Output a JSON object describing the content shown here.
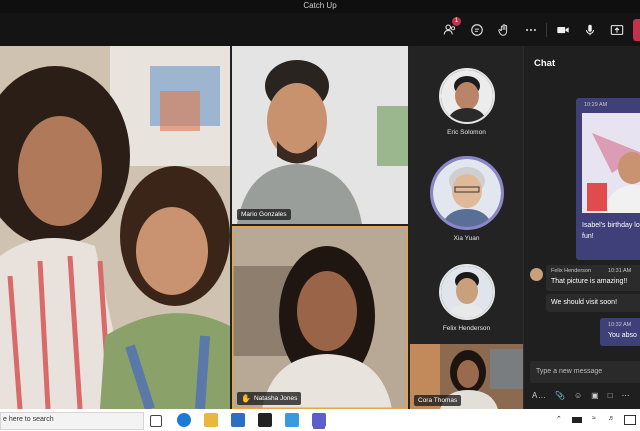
{
  "window": {
    "title": "Catch Up"
  },
  "toolbar": {
    "participants_badge": "1",
    "icons": [
      "people-icon",
      "chat-icon",
      "raise-hand-icon",
      "more-icon",
      "camera-icon",
      "mic-icon",
      "share-icon"
    ]
  },
  "tiles": [
    {
      "name": ""
    },
    {
      "name": "Mario Gonzales"
    },
    {
      "name": "Natasha Jones",
      "hand_raised": true
    }
  ],
  "roster": [
    {
      "name": "Eric Solomon"
    },
    {
      "name": "Xia Yuan",
      "speaking": true
    },
    {
      "name": "Felix Henderson"
    },
    {
      "name": "Cora Thomas"
    }
  ],
  "chat": {
    "title": "Chat",
    "messages": [
      {
        "time": "10:29 AM",
        "text": "Isabel's birthday lot of fun!"
      },
      {
        "sender": "Felix Henderson",
        "time": "10:31 AM",
        "text": "That picture is amazing!!"
      },
      {
        "text": "We should visit soon!"
      },
      {
        "time": "10:32 AM",
        "text": "You abso"
      }
    ],
    "compose_placeholder": "Type a new message"
  },
  "taskbar": {
    "search_placeholder": "e here to search"
  },
  "colors": {
    "accent": "#6264a7",
    "leave": "#c4314b",
    "bubble_me": "#3f3f7a"
  }
}
